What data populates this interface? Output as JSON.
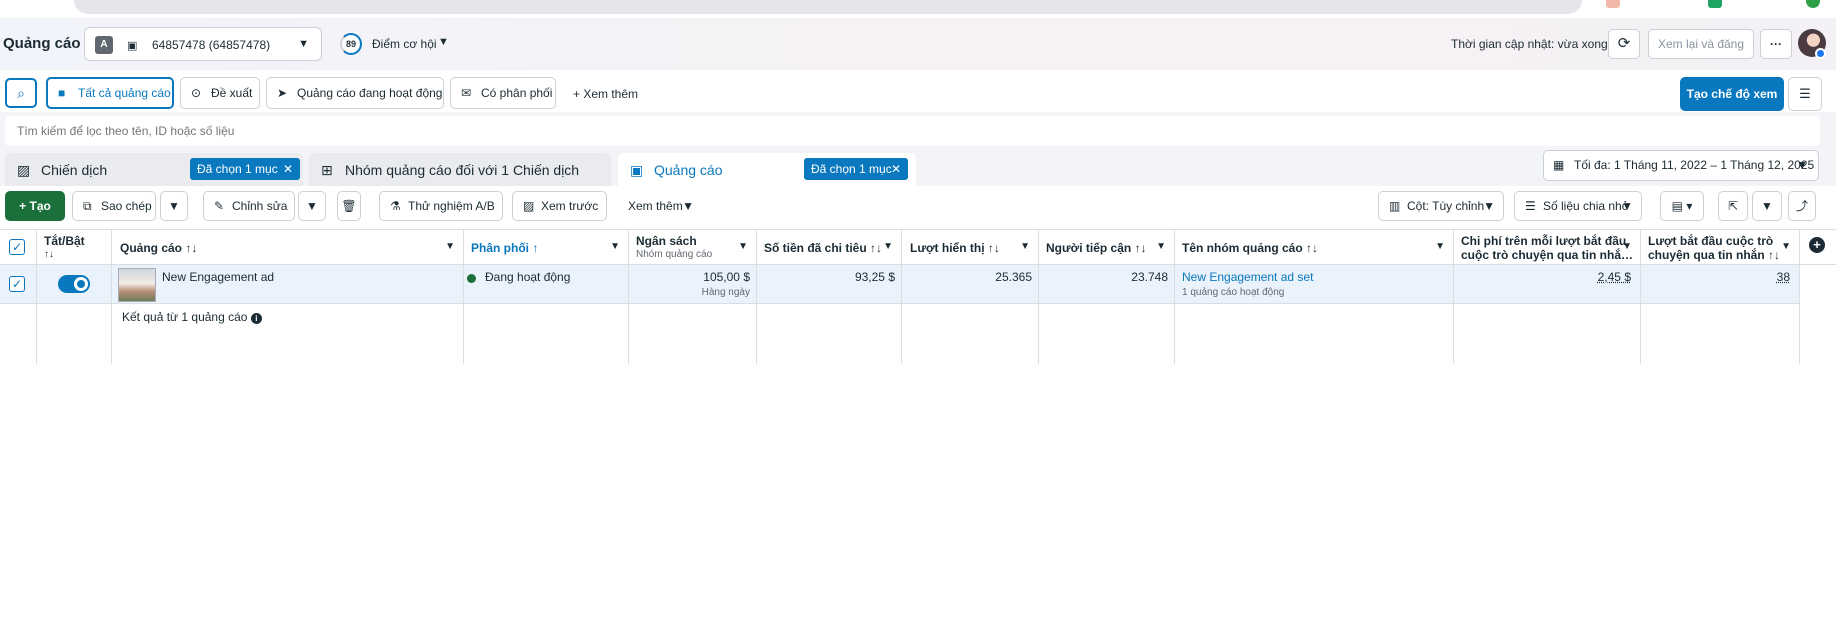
{
  "header": {
    "title": "Quảng cáo",
    "account_badge": "A",
    "account_label": "64857478 (64857478)",
    "score": "89",
    "score_label": "Điểm cơ hội",
    "update_text": "Thời gian cập nhật: vừa xong",
    "review_button": "Xem lại và đăng",
    "more_button": "···"
  },
  "filters": {
    "all_ads": "Tất cả quảng cáo",
    "suggested": "Đề xuất",
    "active_ads": "Quảng cáo đang hoạt động",
    "delivering": "Có phân phối",
    "see_more": "Xem thêm",
    "create_view": "Tạo chế độ xem"
  },
  "search": {
    "placeholder": "Tìm kiếm để lọc theo tên, ID hoặc số liệu"
  },
  "tabs": [
    {
      "label": "Chiến dịch",
      "chip": "Đã chọn 1 mục"
    },
    {
      "label": "Nhóm quảng cáo đối với 1 Chiến dịch"
    },
    {
      "label": "Quảng cáo",
      "chip": "Đã chọn 1 mục"
    }
  ],
  "date_range": "Tối đa: 1 Tháng 11, 2022 – 1 Tháng 12, 2025",
  "actions": {
    "create": "Tạo",
    "duplicate": "Sao chép",
    "edit": "Chỉnh sửa",
    "ab_test": "Thử nghiệm A/B",
    "preview": "Xem trước",
    "more": "Xem thêm",
    "columns": "Cột: Tùy chỉnh",
    "breakdown": "Số liệu chia nhỏ"
  },
  "table": {
    "headers": {
      "toggle": "Tắt/Bật",
      "ad": "Quảng cáo",
      "delivery": "Phân phối",
      "budget": "Ngân sách",
      "budget_sub": "Nhóm quảng cáo",
      "spent": "Số tiền đã chi tiêu",
      "impressions": "Lượt hiển thị",
      "reach": "Người tiếp cận",
      "adset_name": "Tên nhóm quảng cáo",
      "cost_per_conv_l1": "Chi phí trên mỗi lượt bắt đầu",
      "cost_per_conv_l2": "cuộc trò chuyện qua tin nhắ…",
      "conv_l1": "Lượt bắt đầu cuộc trò",
      "conv_l2": "chuyện qua tin nhắn"
    },
    "sort_icon": "↑↓",
    "row": {
      "ad_name": "New Engagement ad",
      "delivery": "Đang hoạt động",
      "budget": "105,00 $",
      "budget_period": "Hàng ngày",
      "spent": "93,25 $",
      "impressions": "25.365",
      "reach": "23.748",
      "adset_name": "New Engagement ad set",
      "adset_sub": "1 quảng cáo hoạt động",
      "cost_per_conv": "2,45 $",
      "conversations": "38"
    },
    "summary": "Kết quả từ 1 quảng cáo"
  }
}
